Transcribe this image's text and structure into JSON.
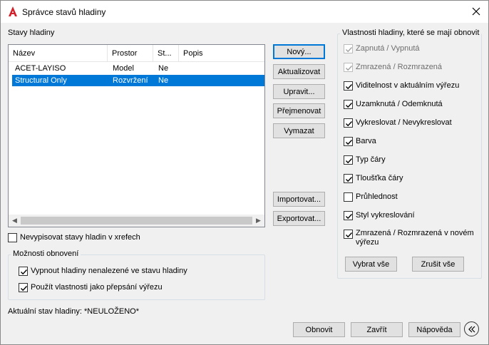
{
  "window": {
    "title": "Správce stavů hladiny",
    "app_icon": "autocad-a-icon",
    "close_icon": "close-icon"
  },
  "left": {
    "list_label": "Stavy hladiny",
    "columns": [
      "Název",
      "Prostor",
      "St...",
      "Popis"
    ],
    "rows": [
      {
        "name": "ACET-LAYISO",
        "space": "Model",
        "state": "Ne",
        "desc": ""
      },
      {
        "name": "Structural Only",
        "space": "Rozvržení",
        "state": "Ne",
        "desc": "",
        "selected": true
      }
    ],
    "no_xref_label": "Nevypisovat stavy hladin v xrefech",
    "restore_group_label": "Možnosti obnovení",
    "restore_options": [
      {
        "label": "Vypnout hladiny nenalezené ve stavu hladiny",
        "checked": true
      },
      {
        "label": "Použít vlastnosti jako přepsání výřezu",
        "checked": true
      }
    ],
    "current_state": "Aktuální stav hladiny: *NEULOŽENO*"
  },
  "buttons": {
    "new": "Nový...",
    "update": "Aktualizovat",
    "edit": "Upravit...",
    "rename": "Přejmenovat",
    "delete": "Vymazat",
    "import": "Importovat...",
    "export": "Exportovat..."
  },
  "right": {
    "group_label": "Vlastnosti hladiny, které se mají obnovit",
    "properties": [
      {
        "label": "Zapnutá / Vypnutá",
        "checked": true,
        "disabled": true
      },
      {
        "label": "Zmrazená / Rozmrazená",
        "checked": true,
        "disabled": true
      },
      {
        "label": "Viditelnost v aktuálním výřezu",
        "checked": true,
        "disabled": false
      },
      {
        "label": "Uzamknutá / Odemknutá",
        "checked": true,
        "disabled": false
      },
      {
        "label": "Vykreslovat / Nevykreslovat",
        "checked": true,
        "disabled": false
      },
      {
        "label": "Barva",
        "checked": true,
        "disabled": false
      },
      {
        "label": "Typ čáry",
        "checked": true,
        "disabled": false
      },
      {
        "label": "Tloušťka čáry",
        "checked": true,
        "disabled": false
      },
      {
        "label": "Průhlednost",
        "checked": false,
        "disabled": false
      },
      {
        "label": "Styl vykreslování",
        "checked": true,
        "disabled": false
      },
      {
        "label": "Zmrazená / Rozmrazená v novém",
        "label2": "výřezu",
        "checked": true,
        "disabled": false
      }
    ],
    "select_all": "Vybrat vše",
    "clear_all": "Zrušit vše"
  },
  "footer": {
    "restore": "Obnovit",
    "close": "Zavřít",
    "help": "Nápověda",
    "collapse_icon": "chevron-left-circle-icon"
  },
  "colors": {
    "selection": "#0078d7",
    "background": "#f0f0f0",
    "accent": "#d4202a"
  }
}
